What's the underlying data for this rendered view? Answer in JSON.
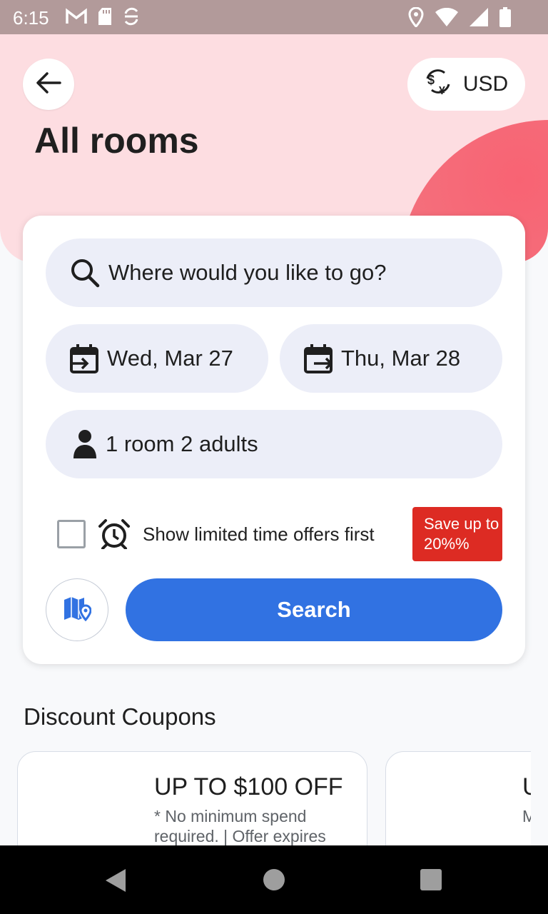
{
  "status_bar": {
    "time": "6:15",
    "left_icons": [
      "gmail-icon",
      "sd-card-icon",
      "sync-icon"
    ],
    "right_icons": [
      "location-icon",
      "wifi-icon",
      "signal-icon",
      "battery-icon"
    ]
  },
  "header": {
    "back_icon": "arrow-left-icon",
    "currency_icon": "currency-exchange-icon",
    "currency_label": "USD",
    "title": "All rooms"
  },
  "search_form": {
    "destination_placeholder": "Where would you like to go?",
    "check_in": "Wed, Mar 27",
    "check_out": "Thu, Mar 28",
    "guests": "1 room 2 adults",
    "limited_offers_label": "Show limited time offers first",
    "limited_offers_checked": false,
    "save_badge": "Save up to 20%%",
    "search_label": "Search",
    "map_icon": "map-location-icon"
  },
  "discount_section": {
    "title": "Discount Coupons",
    "coupons": [
      {
        "title": "UP TO $100 OFF",
        "description": "* No minimum spend required.  | Offer expires"
      },
      {
        "title": "U",
        "description": "M e"
      }
    ]
  },
  "colors": {
    "status_bar": "#b29a9a",
    "hero_bg": "#fddde1",
    "accent_circle": "#f27681",
    "pill_bg": "#eceef8",
    "primary_button": "#3172e2",
    "badge": "#dd2b23"
  }
}
